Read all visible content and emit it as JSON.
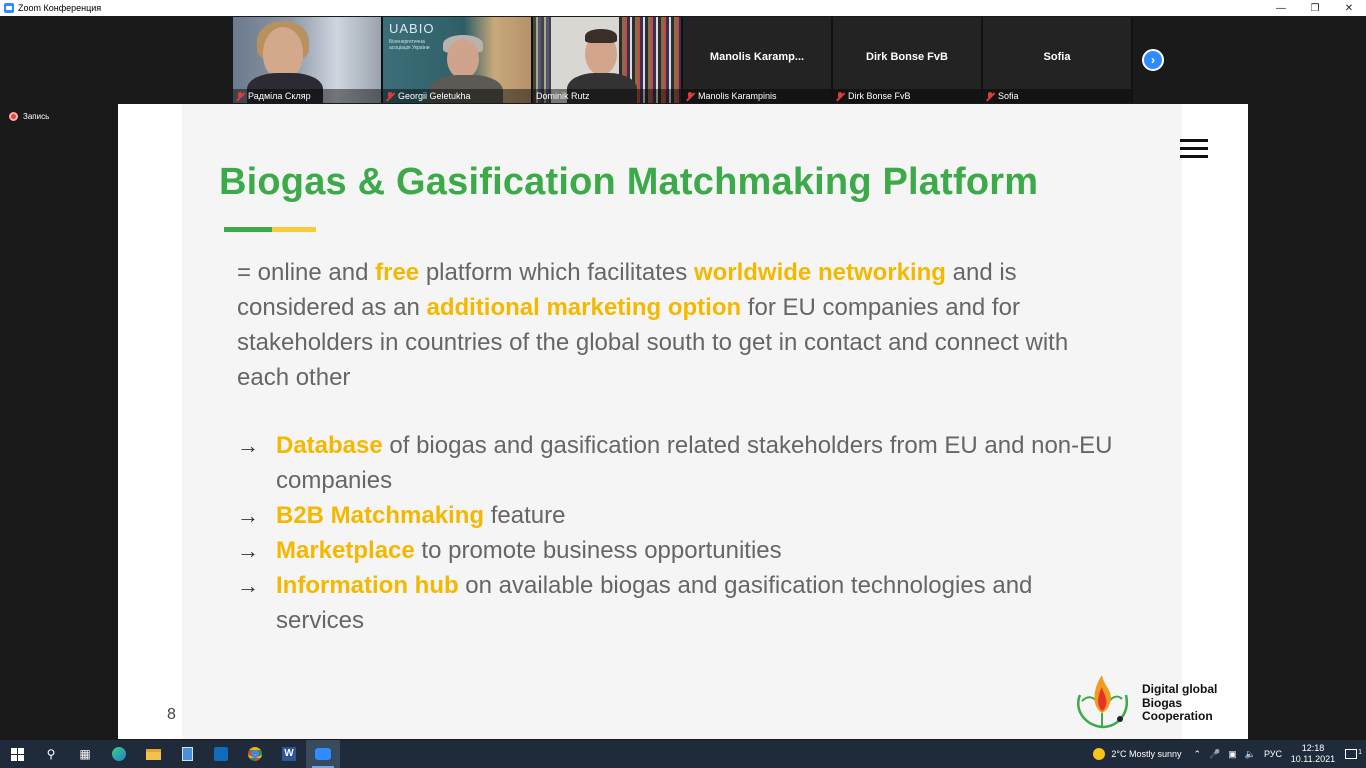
{
  "window": {
    "title": "Zoom Конференция"
  },
  "participants": [
    {
      "name": "Радміла Скляр",
      "video": true,
      "muted": true
    },
    {
      "name": "Georgii Geletukha",
      "video": true,
      "muted": true,
      "background_text": "UABIO",
      "background_subtext": "Біоенергетична асоціація України"
    },
    {
      "name": "Dominik Rutz",
      "video": true,
      "muted": false,
      "active_speaker": true
    },
    {
      "name": "Manolis Karampinis",
      "display_name": "Manolis Karamp...",
      "video": false,
      "muted": true
    },
    {
      "name": "Dirk Bonse FvB",
      "display_name": "Dirk Bonse FvB",
      "video": false,
      "muted": true
    },
    {
      "name": "Sofia",
      "display_name": "Sofia",
      "video": false,
      "muted": true
    }
  ],
  "recording": {
    "label": "Запись"
  },
  "slide": {
    "title": "Biogas & Gasification Matchmaking Platform",
    "intro": {
      "p1": "= online and ",
      "h1": "free",
      "p2": " platform which facilitates ",
      "h2": "worldwide networking",
      "p3": " and is considered as an ",
      "h3": "additional marketing option",
      "p4": " for EU companies and for stakeholders in countries of the global south to get in contact and connect with each other"
    },
    "bullets": [
      {
        "highlight": "Database",
        "text": " of biogas and gasification related stakeholders from EU and non-EU companies"
      },
      {
        "highlight": "B2B Matchmaking",
        "text": " feature"
      },
      {
        "highlight": "Marketplace",
        "text": " to promote business opportunities"
      },
      {
        "highlight": "Information hub",
        "text": " on available biogas and gasification technologies and services"
      }
    ],
    "bullet_glyph": "→",
    "page_number": "8",
    "logo_text": {
      "line1": "Digital global",
      "line2": "Biogas",
      "line3": "Cooperation"
    },
    "colors": {
      "title_green": "#3caa48",
      "highlight_yellow": "#f5b800",
      "body_gray": "#666666"
    }
  },
  "taskbar": {
    "weather": "2°C  Mostly sunny",
    "language": "РУС",
    "time": "12:18",
    "date": "10.11.2021",
    "notification_count": "1",
    "apps": [
      "search-icon",
      "task-view-icon",
      "edge-icon",
      "file-explorer-icon",
      "calculator-icon",
      "outlook-icon",
      "chrome-icon",
      "word-icon",
      "zoom-icon"
    ]
  }
}
